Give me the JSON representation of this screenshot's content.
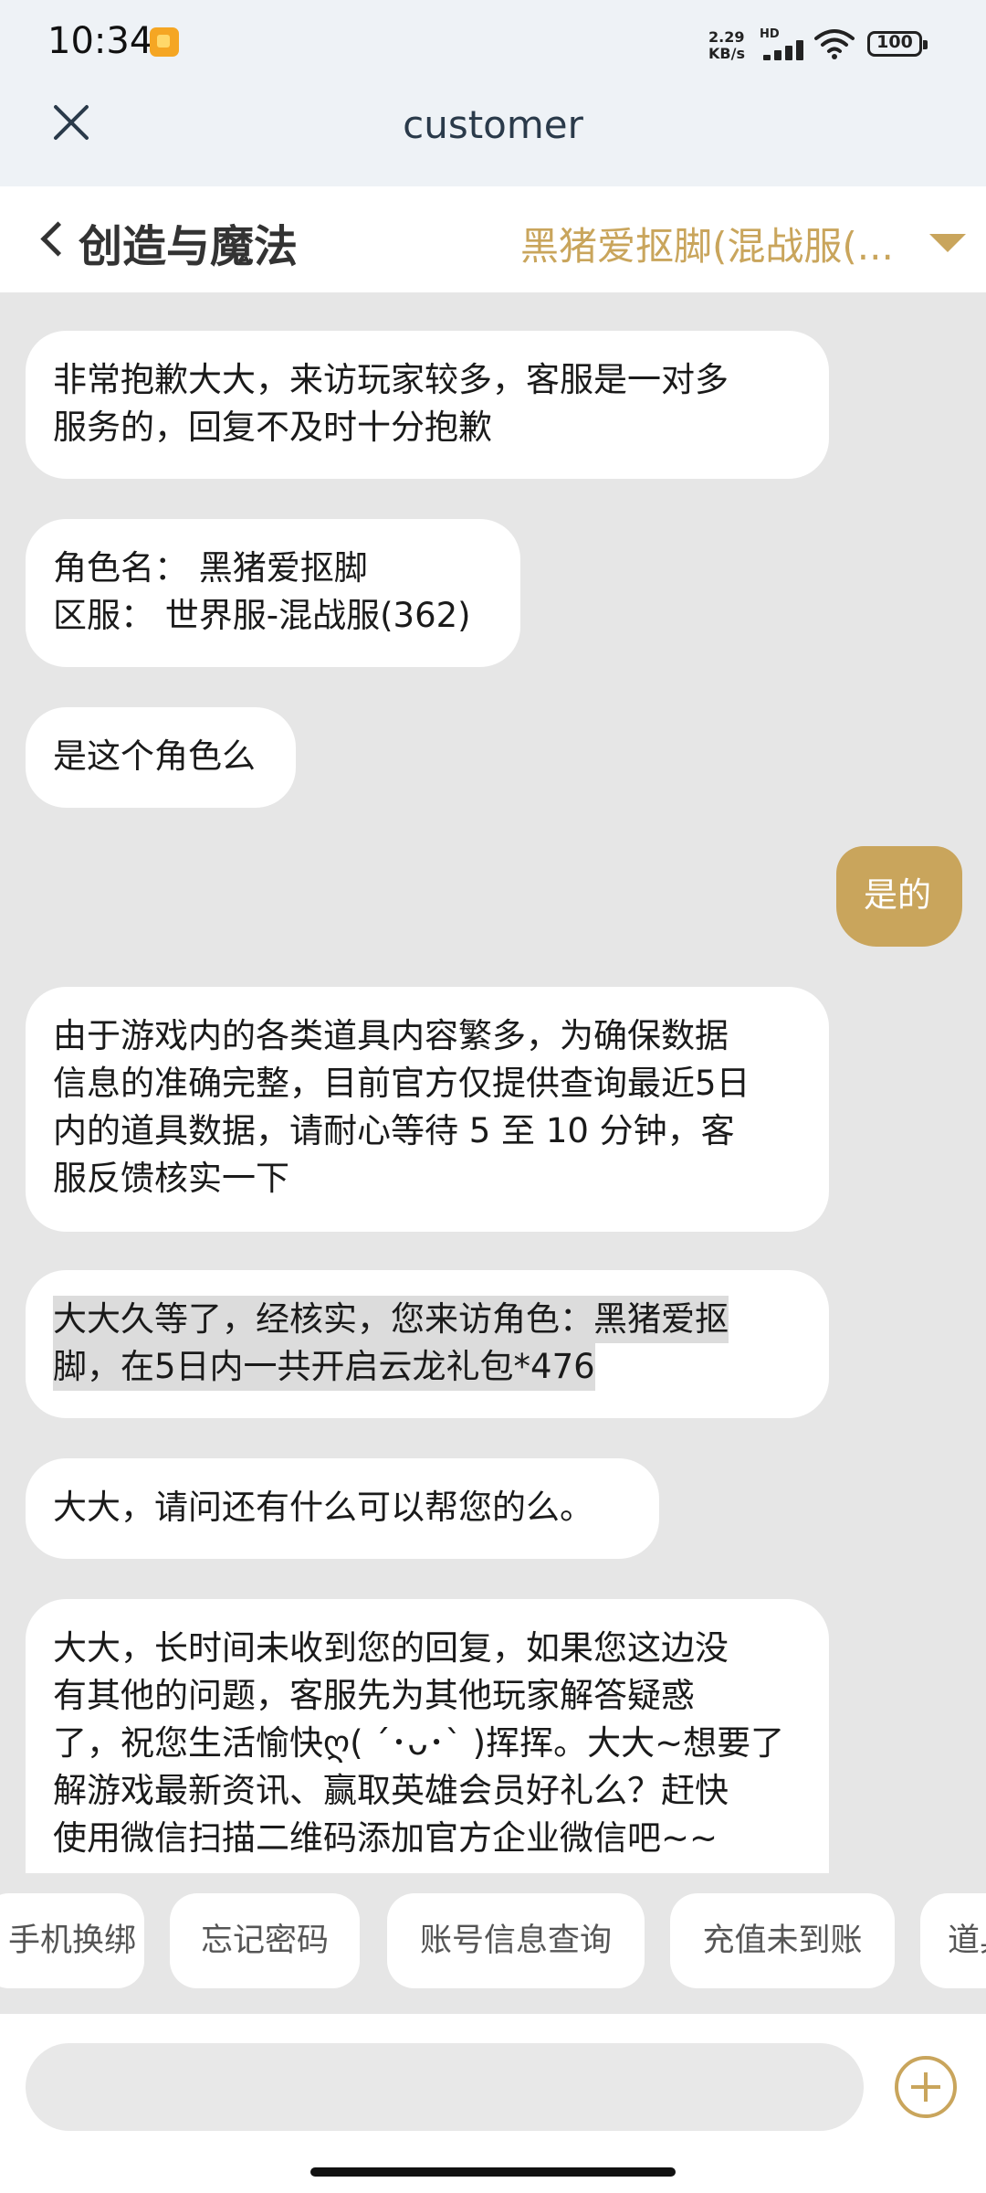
{
  "status_bar": {
    "time": "10:34",
    "net_speed_value": "2.29",
    "net_speed_unit": "KB/s",
    "hd": "HD",
    "battery": "100"
  },
  "window": {
    "title": "customer"
  },
  "header": {
    "game_title": "创造与魔法",
    "server": "黑猪爱抠脚(混战服(..."
  },
  "messages": [
    {
      "sender": "agent",
      "lines": [
        "非常抱歉大大，来访玩家较多，客服是一对多",
        "服务的，回复不及时十分抱歉"
      ]
    },
    {
      "sender": "agent",
      "lines": [
        "角色名： 黑猪爱抠脚",
        "区服： 世界服-混战服(362)"
      ]
    },
    {
      "sender": "agent",
      "lines": [
        "是这个角色么"
      ]
    },
    {
      "sender": "user",
      "lines": [
        "是的"
      ]
    },
    {
      "sender": "agent",
      "lines": [
        "由于游戏内的各类道具内容繁多，为确保数据",
        "信息的准确完整，目前官方仅提供查询最近5日",
        "内的道具数据，请耐心等待 5 至 10 分钟，客",
        "服反馈核实一下"
      ]
    },
    {
      "sender": "agent",
      "lines": [
        "大大久等了，经核实，您来访角色：黑猪爱抠",
        "脚，在5日内一共开启云龙礼包*476"
      ]
    },
    {
      "sender": "agent",
      "lines": [
        "大大，请问还有什么可以帮您的么。"
      ]
    },
    {
      "sender": "agent",
      "lines": [
        "大大，长时间未收到您的回复，如果您这边没",
        "有其他的问题，客服先为其他玩家解答疑惑",
        "了，祝您生活愉快ღ( ´･ᴗ･` )挥挥。大大~想要了",
        "解游戏最新资讯、赢取英雄会员好礼么？赶快",
        "使用微信扫描二维码添加官方企业微信吧~~"
      ]
    }
  ],
  "quick_replies": [
    "手机换绑",
    "忘记密码",
    "账号信息查询",
    "充值未到账",
    "道具"
  ],
  "input": {
    "value": "",
    "placeholder": ""
  },
  "colors": {
    "accent": "#c9a55c",
    "chat_bg": "#e6e6e6",
    "bubble_bg": "#ffffff"
  },
  "icons": [
    "close-icon",
    "back-icon",
    "dropdown-icon",
    "plus-icon",
    "signal-icon",
    "wifi-icon",
    "battery-icon"
  ]
}
